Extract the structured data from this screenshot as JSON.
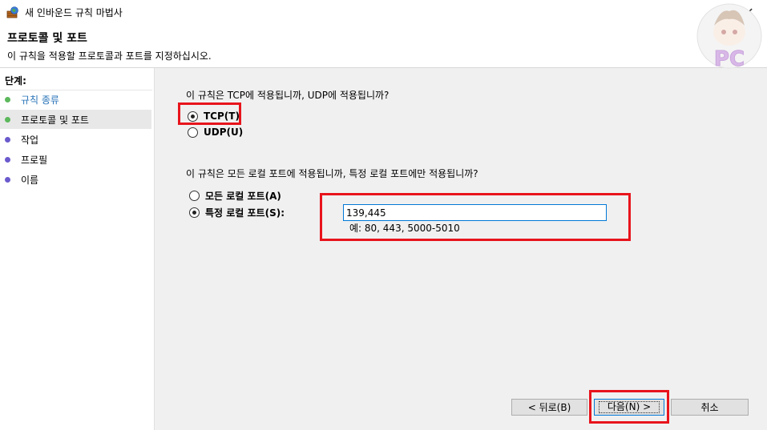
{
  "window": {
    "title": "새 인바운드 규칙 마법사",
    "close_glyph": "✕"
  },
  "header": {
    "title": "프로토콜 및 포트",
    "description": "이 규칙을 적용할 프로토콜과 포트를 지정하십시오."
  },
  "sidebar": {
    "steps_label": "단계:",
    "items": [
      {
        "label": "규칙 종류",
        "color": "#2a74b8",
        "dot": "#5cb85c"
      },
      {
        "label": "프로토콜 및 포트",
        "color": "#000000",
        "dot": "#5cb85c"
      },
      {
        "label": "작업",
        "color": "#000000",
        "dot": "#6a5acd"
      },
      {
        "label": "프로필",
        "color": "#000000",
        "dot": "#6a5acd"
      },
      {
        "label": "이름",
        "color": "#000000",
        "dot": "#6a5acd"
      }
    ]
  },
  "protocol": {
    "question": "이 규칙은 TCP에 적용됩니까, UDP에 적용됩니까?",
    "options": [
      {
        "label": "TCP(T)",
        "checked": true
      },
      {
        "label": "UDP(U)",
        "checked": false
      }
    ]
  },
  "ports": {
    "question": "이 규칙은 모든 로컬 포트에 적용됩니까, 특정 로컬 포트에만 적용됩니까?",
    "options": [
      {
        "label": "모든 로컬 포트(A)",
        "checked": false
      },
      {
        "label": "특정 로컬 포트(S):",
        "checked": true
      }
    ],
    "input_value": "139,445",
    "example": "예: 80, 443, 5000-5010"
  },
  "buttons": {
    "back": "< 뒤로(B)",
    "next": "다음(N) >",
    "cancel": "취소"
  },
  "watermark": {
    "text": "PC"
  },
  "colors": {
    "highlight": "#e8141c",
    "accent": "#0078d7"
  }
}
